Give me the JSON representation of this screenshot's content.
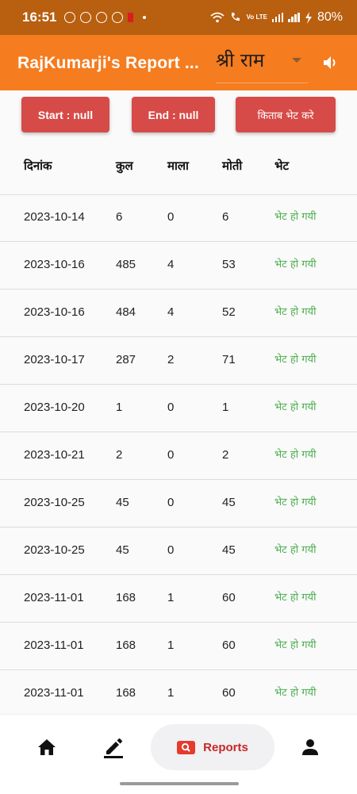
{
  "status_bar": {
    "time": "16:51",
    "network_label": "Vo LTE",
    "battery": "80%"
  },
  "app_bar": {
    "title": "RajKumarji's Report ...",
    "dropdown_value": "श्री राम",
    "speaker_icon": "volume-icon"
  },
  "actions": {
    "start_label": "Start : null",
    "end_label": "End : null",
    "gift_label": "किताब भेट करे"
  },
  "table": {
    "headers": [
      "दिनांक",
      "कुल",
      "माला",
      "मोती",
      "भेट"
    ],
    "rows": [
      [
        "2023-10-14",
        "6",
        "0",
        "6",
        "भेट हो गयी"
      ],
      [
        "2023-10-16",
        "485",
        "4",
        "53",
        "भेट हो गयी"
      ],
      [
        "2023-10-16",
        "484",
        "4",
        "52",
        "भेट हो गयी"
      ],
      [
        "2023-10-17",
        "287",
        "2",
        "71",
        "भेट हो गयी"
      ],
      [
        "2023-10-20",
        "1",
        "0",
        "1",
        "भेट हो गयी"
      ],
      [
        "2023-10-21",
        "2",
        "0",
        "2",
        "भेट हो गयी"
      ],
      [
        "2023-10-25",
        "45",
        "0",
        "45",
        "भेट हो गयी"
      ],
      [
        "2023-10-25",
        "45",
        "0",
        "45",
        "भेट हो गयी"
      ],
      [
        "2023-11-01",
        "168",
        "1",
        "60",
        "भेट हो गयी"
      ],
      [
        "2023-11-01",
        "168",
        "1",
        "60",
        "भेट हो गयी"
      ],
      [
        "2023-11-01",
        "168",
        "1",
        "60",
        "भेट हो गयी"
      ]
    ],
    "status_color": "#4caf50"
  },
  "bottom_nav": {
    "items": [
      {
        "icon": "home-icon"
      },
      {
        "icon": "edit-icon"
      },
      {
        "icon": "search-icon",
        "label": "Reports"
      },
      {
        "icon": "person-icon"
      }
    ]
  },
  "colors": {
    "status_bar": "#b85f10",
    "app_bar": "#f57c1f",
    "button": "#d64b48",
    "reports_accent": "#c62828"
  }
}
